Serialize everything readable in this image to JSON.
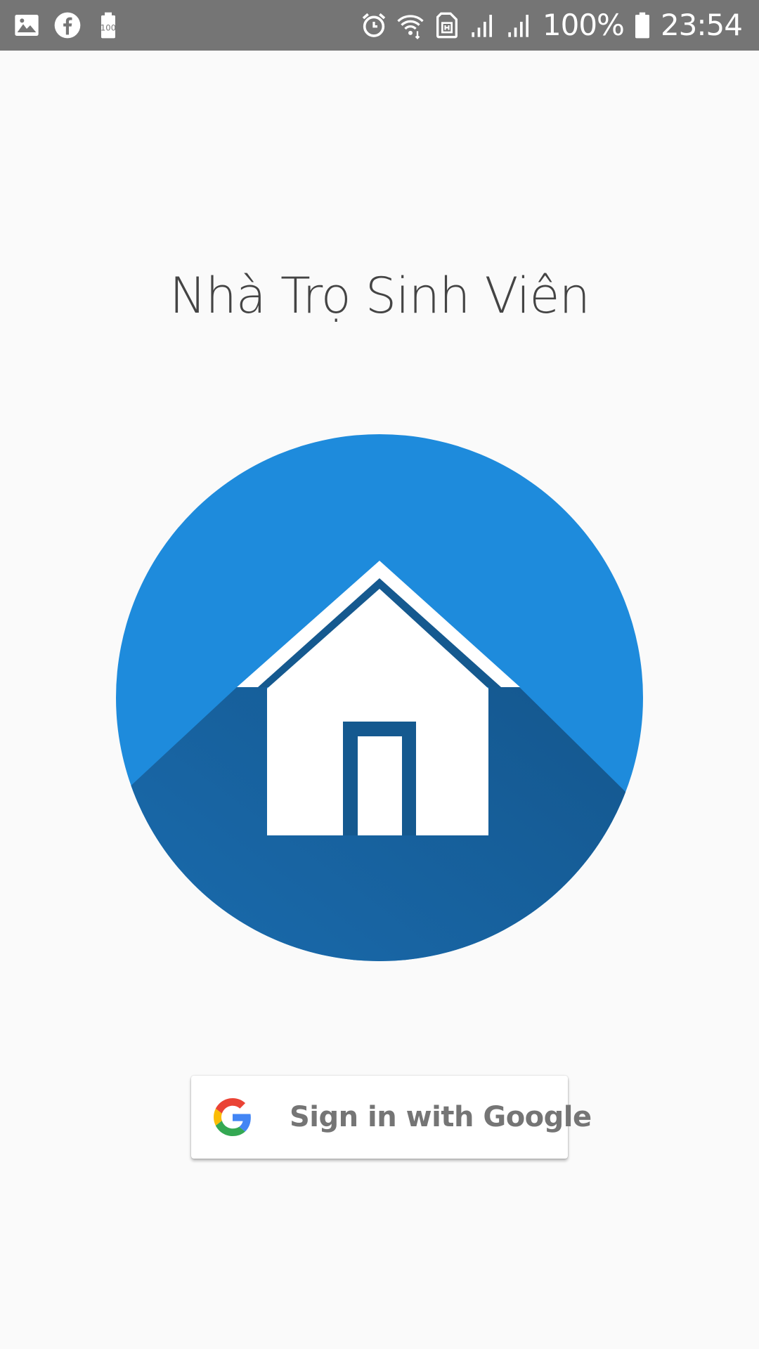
{
  "status_bar": {
    "battery_percent": "100%",
    "time": "23:54",
    "left_icons": [
      "image-icon",
      "facebook-icon",
      "battery-saver-icon"
    ],
    "right_icons": [
      "alarm-icon",
      "wifi-icon",
      "sim-icon",
      "signal-icon",
      "signal-icon",
      "battery-icon"
    ]
  },
  "app": {
    "title": "Nhà Trọ Sinh Viên",
    "logo_icon": "house-icon",
    "colors": {
      "logo_circle": "#1e8bdc",
      "logo_shadow": "#15598f",
      "status_bar": "#757575",
      "background": "#fafafa"
    }
  },
  "sign_in": {
    "label": "Sign in with Google",
    "icon": "google-icon"
  }
}
